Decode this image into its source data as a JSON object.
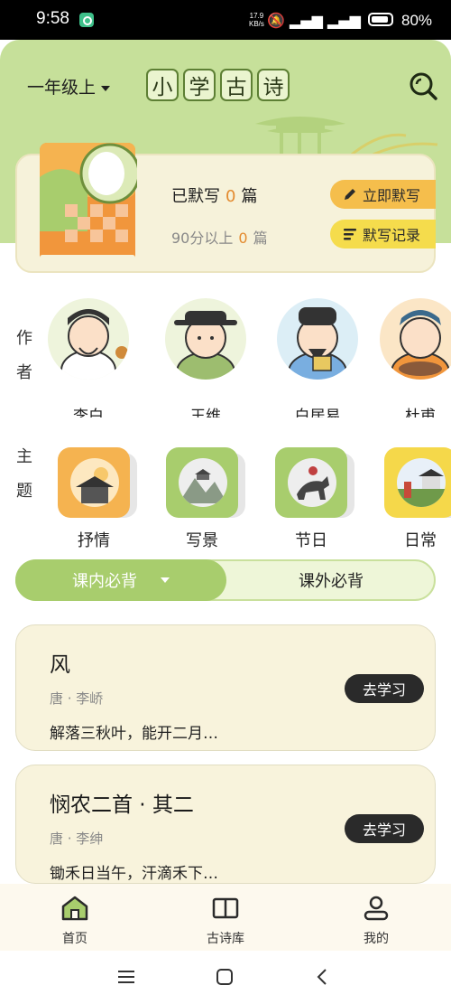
{
  "status_bar": {
    "time": "9:58",
    "net_speed_value": "17.9",
    "net_speed_unit": "KB/s",
    "signal_icons": "🔕 ▂▄▆ ▂▄▆ ",
    "battery_percent": "80%"
  },
  "header": {
    "grade": "一年级上",
    "title_chars": [
      "小",
      "学",
      "古",
      "诗"
    ],
    "accent_color": "#c6e09a"
  },
  "progress": {
    "done_prefix": "已默写",
    "done_count": "0",
    "done_unit": "篇",
    "high_prefix": "90分以上",
    "high_count": "0",
    "high_unit": "篇",
    "dictate_label": "立即默写",
    "record_label": "默写记录"
  },
  "authors": {
    "label": "作者",
    "items": [
      {
        "name": "李白"
      },
      {
        "name": "王维"
      },
      {
        "name": "白居易"
      },
      {
        "name": "杜甫"
      }
    ]
  },
  "themes": {
    "label": "主题",
    "items": [
      {
        "name": "抒情",
        "color": "#f5b350"
      },
      {
        "name": "写景",
        "color": "#a8cd6d"
      },
      {
        "name": "节日",
        "color": "#a8cd6d"
      },
      {
        "name": "日常",
        "color": "#f5d84a"
      }
    ]
  },
  "tabs": {
    "in_class": "课内必背",
    "out_class": "课外必背"
  },
  "poems": [
    {
      "title": "风",
      "meta": "唐 · 李峤",
      "line": "解落三秋叶，能开二月…",
      "action": "去学习"
    },
    {
      "title": "悯农二首 · 其二",
      "meta": "唐 · 李绅",
      "line": "锄禾日当午，汗滴禾下…",
      "action": "去学习"
    }
  ],
  "bottom_nav": {
    "home": "首页",
    "library": "古诗库",
    "mine": "我的"
  }
}
